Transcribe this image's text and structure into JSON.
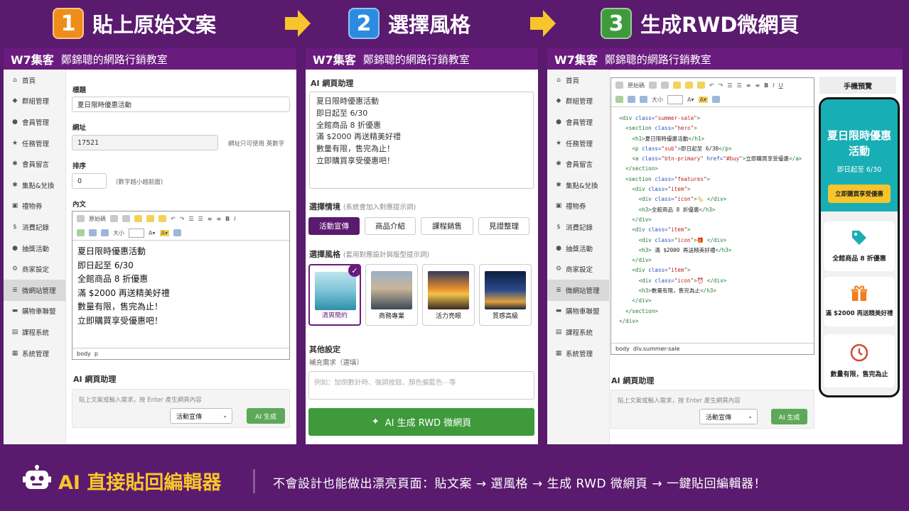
{
  "steps": [
    {
      "num": "1",
      "label": "貼上原始文案",
      "color": "#f08c1a"
    },
    {
      "num": "2",
      "label": "選擇風格",
      "color": "#2b8be0"
    },
    {
      "num": "3",
      "label": "生成RWD微網頁",
      "color": "#3e9a3a"
    }
  ],
  "brand": {
    "name": "W7集客",
    "subtitle": "鄭錦聰的網路行銷教室"
  },
  "sidebar": [
    {
      "icon": "home-icon",
      "glyph": "⌂",
      "label": "首頁"
    },
    {
      "icon": "tag-icon",
      "glyph": "◆",
      "label": "群組管理"
    },
    {
      "icon": "user-icon",
      "glyph": "●",
      "label": "會員管理"
    },
    {
      "icon": "star-icon",
      "glyph": "★",
      "label": "任務管理"
    },
    {
      "icon": "asterisk-icon",
      "glyph": "✱",
      "label": "會員留言"
    },
    {
      "icon": "asterisk-icon",
      "glyph": "✱",
      "label": "集點&兌換"
    },
    {
      "icon": "gift-icon",
      "glyph": "▣",
      "label": "禮物券"
    },
    {
      "icon": "dollar-icon",
      "glyph": "$",
      "label": "消費記錄"
    },
    {
      "icon": "apple-icon",
      "glyph": "●",
      "label": "抽獎活動"
    },
    {
      "icon": "gear-icon",
      "glyph": "⚙",
      "label": "商家設定"
    },
    {
      "icon": "list-icon",
      "glyph": "≣",
      "label": "微網站管理"
    },
    {
      "icon": "cart-icon",
      "glyph": "▬",
      "label": "購物車聯盟"
    },
    {
      "icon": "book-icon",
      "glyph": "▤",
      "label": "課程系統"
    },
    {
      "icon": "grid-icon",
      "glyph": "▦",
      "label": "系統管理"
    }
  ],
  "form": {
    "title_label": "標題",
    "title_value": "夏日限時優惠活動",
    "url_label": "網址",
    "url_value": "17521",
    "url_hint": "網址只可使用 英數字",
    "order_label": "排序",
    "order_value": "0",
    "order_hint": "(數字越小越前面)",
    "content_label": "內文"
  },
  "toolbar": {
    "source": "原始碼",
    "size": "大小"
  },
  "content_lines": [
    "夏日限時優惠活動",
    "即日起至 6/30",
    "全館商品 8 折優惠",
    "滿 $2000 再送精美好禮",
    "數量有限，售完為止！",
    "立即購買享受優惠吧！"
  ],
  "editor_path": {
    "p1": "body",
    "p2": "p"
  },
  "code_path": {
    "p1": "body",
    "p2": "div.summer-sale"
  },
  "ai_box": {
    "title": "AI 網頁助理",
    "placeholder": "貼上文案或輸入需求，按 Enter 產生網頁內容",
    "select": "活動宣傳",
    "button": "AI 生成"
  },
  "panel2": {
    "section_title": "AI 網頁助理",
    "scenario_title": "選擇情境",
    "scenario_hint": "(系統會加入對應提示詞)",
    "scenarios": [
      "活動宣傳",
      "商品介紹",
      "課程銷售",
      "見證整理"
    ],
    "style_title": "選擇風格",
    "style_hint": "(套用對應設計與版型提示詞)",
    "styles": [
      "清爽簡約",
      "商務專業",
      "活力亮眼",
      "質感高級"
    ],
    "other_title": "其他設定",
    "extra_label": "補充需求（選填）",
    "extra_placeholder": "例如：加倒數計時、強調按鈕、顏色偏藍色⋯等",
    "generate_button": "AI 生成 RWD 微網頁"
  },
  "preview": {
    "title": "手機預覽",
    "hero_title": "夏日限時優惠活動",
    "hero_sub": "即日起至 6/30",
    "hero_button": "立即購買享受優惠",
    "features": [
      "全館商品 8 折優惠",
      "滿 $2000 再送精美好禮",
      "數量有限，售完為止"
    ]
  },
  "code_lines": [
    [
      [
        "t",
        "<div "
      ],
      [
        "a",
        "class="
      ],
      [
        "s",
        "\"summer-sale\""
      ],
      [
        "t",
        ">"
      ]
    ],
    [
      [
        "x",
        "  "
      ],
      [
        "t",
        "<section "
      ],
      [
        "a",
        "class="
      ],
      [
        "s",
        "\"hero\""
      ],
      [
        "t",
        ">"
      ]
    ],
    [
      [
        "x",
        "    "
      ],
      [
        "t",
        "<h1>"
      ],
      [
        "x",
        "夏日限時優惠活動"
      ],
      [
        "t",
        "</h1>"
      ]
    ],
    [
      [
        "x",
        "    "
      ],
      [
        "t",
        "<p "
      ],
      [
        "a",
        "class="
      ],
      [
        "s",
        "\"sub\""
      ],
      [
        "t",
        ">"
      ],
      [
        "x",
        "即日起至 6/30"
      ],
      [
        "t",
        "</p>"
      ]
    ],
    [
      [
        "x",
        "    "
      ],
      [
        "t",
        "<a "
      ],
      [
        "a",
        "class="
      ],
      [
        "s",
        "\"btn-primary\" "
      ],
      [
        "a",
        "href="
      ],
      [
        "s",
        "\"#buy\""
      ],
      [
        "t",
        ">"
      ],
      [
        "x",
        "立即購買享受優惠"
      ],
      [
        "t",
        "</a>"
      ]
    ],
    [
      [
        "x",
        "  "
      ],
      [
        "t",
        "</section>"
      ]
    ],
    [
      [
        "x",
        "  "
      ],
      [
        "t",
        "<section "
      ],
      [
        "a",
        "class="
      ],
      [
        "s",
        "\"features\""
      ],
      [
        "t",
        ">"
      ]
    ],
    [
      [
        "x",
        "    "
      ],
      [
        "t",
        "<div "
      ],
      [
        "a",
        "class="
      ],
      [
        "s",
        "\"item\""
      ],
      [
        "t",
        ">"
      ]
    ],
    [
      [
        "x",
        "      "
      ],
      [
        "t",
        "<div "
      ],
      [
        "a",
        "class="
      ],
      [
        "s",
        "\"icon\""
      ],
      [
        "t",
        ">"
      ],
      [
        "x",
        "🏷️ "
      ],
      [
        "t",
        "</div>"
      ]
    ],
    [
      [
        "x",
        "      "
      ],
      [
        "t",
        "<h3>"
      ],
      [
        "x",
        "全館商品 8 折優惠"
      ],
      [
        "t",
        "</h3>"
      ]
    ],
    [
      [
        "x",
        "    "
      ],
      [
        "t",
        "</div>"
      ]
    ],
    [
      [
        "x",
        "    "
      ],
      [
        "t",
        "<div "
      ],
      [
        "a",
        "class="
      ],
      [
        "s",
        "\"item\""
      ],
      [
        "t",
        ">"
      ]
    ],
    [
      [
        "x",
        "      "
      ],
      [
        "t",
        "<div "
      ],
      [
        "a",
        "class="
      ],
      [
        "s",
        "\"icon\""
      ],
      [
        "t",
        ">"
      ],
      [
        "x",
        "🎁 "
      ],
      [
        "t",
        "</div>"
      ]
    ],
    [
      [
        "x",
        "      "
      ],
      [
        "t",
        "<h3>"
      ],
      [
        "x",
        " 滿 $2000 再送精美好禮"
      ],
      [
        "t",
        "</h3>"
      ]
    ],
    [
      [
        "x",
        "    "
      ],
      [
        "t",
        "</div>"
      ]
    ],
    [
      [
        "x",
        "    "
      ],
      [
        "t",
        "<div "
      ],
      [
        "a",
        "class="
      ],
      [
        "s",
        "\"item\""
      ],
      [
        "t",
        ">"
      ]
    ],
    [
      [
        "x",
        "      "
      ],
      [
        "t",
        "<div "
      ],
      [
        "a",
        "class="
      ],
      [
        "s",
        "\"icon\""
      ],
      [
        "t",
        ">"
      ],
      [
        "x",
        "⏰ "
      ],
      [
        "t",
        "</div>"
      ]
    ],
    [
      [
        "x",
        "      "
      ],
      [
        "t",
        "<h3>"
      ],
      [
        "x",
        "數量有限，售完為止"
      ],
      [
        "t",
        "</h3>"
      ]
    ],
    [
      [
        "x",
        "    "
      ],
      [
        "t",
        "</div>"
      ]
    ],
    [
      [
        "x",
        "  "
      ],
      [
        "t",
        "</section>"
      ]
    ],
    [
      [
        "t",
        "</div>"
      ]
    ]
  ],
  "footer": {
    "badge": "AI 直接貼回編輯器",
    "tagline": "不會設計也能做出漂亮頁面：貼文案 → 選風格 → 生成 RWD 微網頁 → 一鍵貼回編輯器！"
  },
  "colors": {
    "brand_purple": "#5a1a6e",
    "accent_yellow": "#f7c52b",
    "hero_teal": "#18aeb5",
    "button_green": "#3e9a3a"
  }
}
